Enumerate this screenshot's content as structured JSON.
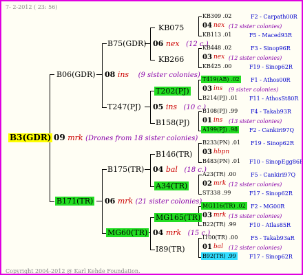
{
  "header": {
    "date": "7-  2-2012 ( 23: 56)"
  },
  "footer": {
    "copyright": "Copyright 2004-2012 @ Karl Kehde Foundation."
  },
  "root": {
    "name": "B3(GDR)",
    "gen": "09",
    "mark": "mrk",
    "note": "(Drones from 18 sister colonies)"
  },
  "g1": [
    {
      "name": "B06(GDR)",
      "gen": "08",
      "mark": "ins",
      "note": "(9 sister colonies)"
    },
    {
      "name": "B171(TR)",
      "gen": "06",
      "mark": "mrk",
      "note": "(21 sister colonies)"
    }
  ],
  "g2": [
    {
      "name": "B75(GDR)",
      "gen": "06",
      "mark": "nex",
      "note": "(12 c.)"
    },
    {
      "name": "T247(PJ)",
      "gen": "05",
      "mark": "ins",
      "note": "(10 c.)"
    },
    {
      "name": "B175(TR)",
      "gen": "04",
      "mark": "bal",
      "note": "(18 c.)"
    },
    {
      "name": "MG60(TR)",
      "gen": "04",
      "mark": "mrk",
      "note": "(15 c.)"
    }
  ],
  "g3": [
    {
      "name": "KB075"
    },
    {
      "name": "KB266"
    },
    {
      "name": "T202(PJ)"
    },
    {
      "name": "B158(PJ)"
    },
    {
      "name": "B146(TR)"
    },
    {
      "name": "A34(TR)"
    },
    {
      "name": "MG165(TR)"
    },
    {
      "name": "I89(TR)"
    }
  ],
  "g4": [
    {
      "top": "KB309 .02",
      "top_loc": "F2 - Carpath00R",
      "gen": "04",
      "mark": "nex",
      "note": "(12 sister colonies)",
      "bot": "KB113 .01",
      "bot_loc": "F5 - Maced93R"
    },
    {
      "top": "KB448 .02",
      "top_loc": "F3 - Sinop96R",
      "gen": "03",
      "mark": "nex",
      "note": "(12 sister colonies)",
      "bot": "KB425 .00",
      "bot_loc": "F19 - Sinop62R"
    },
    {
      "top": "T419(AB) .02",
      "top_loc": "F1 - Athos00R",
      "gen": "03",
      "mark": "ins",
      "note": "(9 sister colonies)",
      "bot": "B214(PJ) .01",
      "bot_loc": "F11 - AthosSt80R"
    },
    {
      "top": "B108(PJ) .99",
      "top_loc": "F4 - Takab93R",
      "gen": "01",
      "mark": "ins",
      "note": "(13 sister colonies)",
      "bot": "A199(PJ) .98",
      "bot_loc": "F2 - Cankiri97Q"
    },
    {
      "top": "B233(PN) .01",
      "top_loc": "F19 - Sinop62R",
      "gen": "03",
      "mark": "hbpn",
      "note": "",
      "bot": "B483(PN) .01",
      "bot_loc": "F10 - SinopEgg86R"
    },
    {
      "top": "A23(TR) .00",
      "top_loc": "F5 - Cankiri97Q",
      "gen": "02",
      "mark": "mrk",
      "note": "(12 sister colonies)",
      "bot": "ST338 .99",
      "bot_loc": "F17 - Sinop62R"
    },
    {
      "top": "MG116(TR) .02",
      "top_loc": "F2 - MG00R",
      "gen": "03",
      "mark": "mrk",
      "note": "(15 sister colonies)",
      "bot": "B22(TR) .99",
      "bot_loc": "F10 - Atlas85R"
    },
    {
      "top": "I100(TR) .00",
      "top_loc": "F5 - Takab93aR",
      "gen": "01",
      "mark": "bal",
      "note": "(12 sister colonies)",
      "bot": "B92(TR) .99",
      "bot_loc": "F17 - Sinop62R"
    }
  ]
}
